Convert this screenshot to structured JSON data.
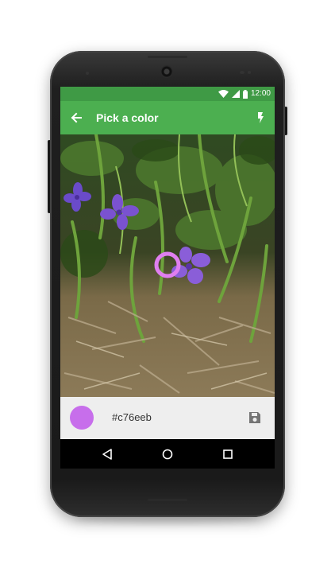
{
  "status_bar": {
    "time": "12:00",
    "icons": [
      "wifi-icon",
      "signal-icon",
      "battery-icon"
    ]
  },
  "app_bar": {
    "title": "Pick a color",
    "color": "#4caf50",
    "status_color": "#3f9a45",
    "icons": [
      "arrow-back-icon",
      "flash-icon"
    ]
  },
  "picker": {
    "hex": "#c76eeb",
    "swatch_color": "#c76eeb",
    "reticle_color": "#e07ff0",
    "save_icon": "save-icon"
  },
  "nav_bar": {
    "icons": [
      "nav-back-icon",
      "nav-home-icon",
      "nav-recents-icon"
    ]
  }
}
